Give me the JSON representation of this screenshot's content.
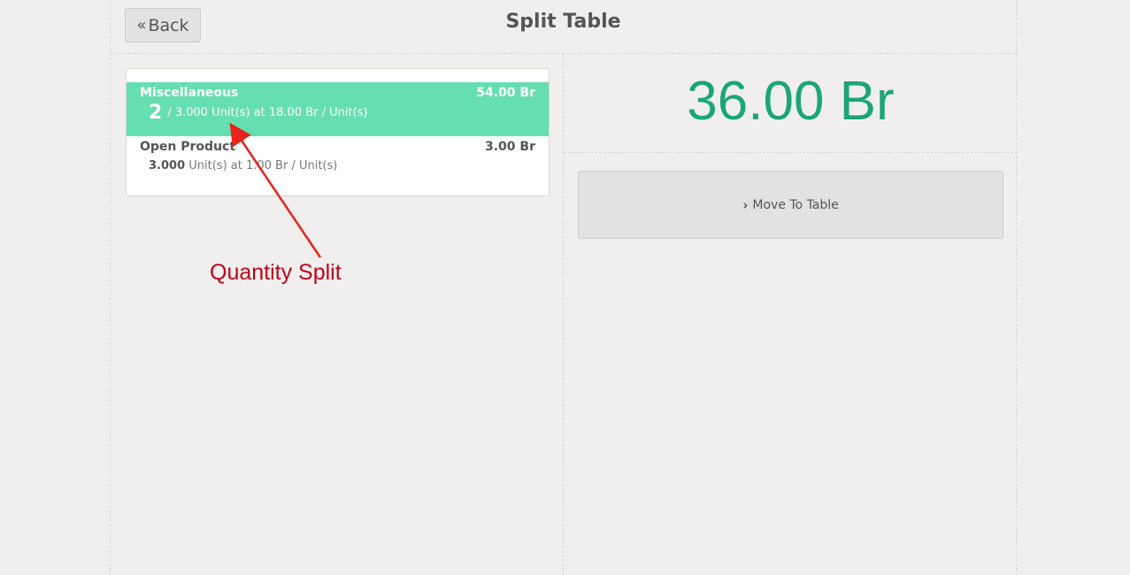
{
  "header": {
    "back_label": "Back",
    "back_icon": "double-chevron-left-icon",
    "title": "Split Table"
  },
  "orderlines": [
    {
      "name": "Miscellaneous",
      "price": "54.00 Br",
      "split_qty": "2",
      "info": "/ 3.000 Unit(s) at 18.00 Br / Unit(s)",
      "selected": true
    },
    {
      "name": "Open Product",
      "price": "3.00 Br",
      "qty": "3.000",
      "info": "Unit(s) at 1.00 Br / Unit(s)",
      "selected": false
    }
  ],
  "summary": {
    "total": "36.00 Br",
    "total_color": "#1ca575"
  },
  "actions": {
    "move_label": "Move To Table",
    "move_icon": "chevron-right-icon"
  },
  "annotation": {
    "text": "Quantity Split",
    "color": "#c0001a"
  },
  "colors": {
    "selected_line": "#65deb0",
    "background": "#f0efed"
  }
}
